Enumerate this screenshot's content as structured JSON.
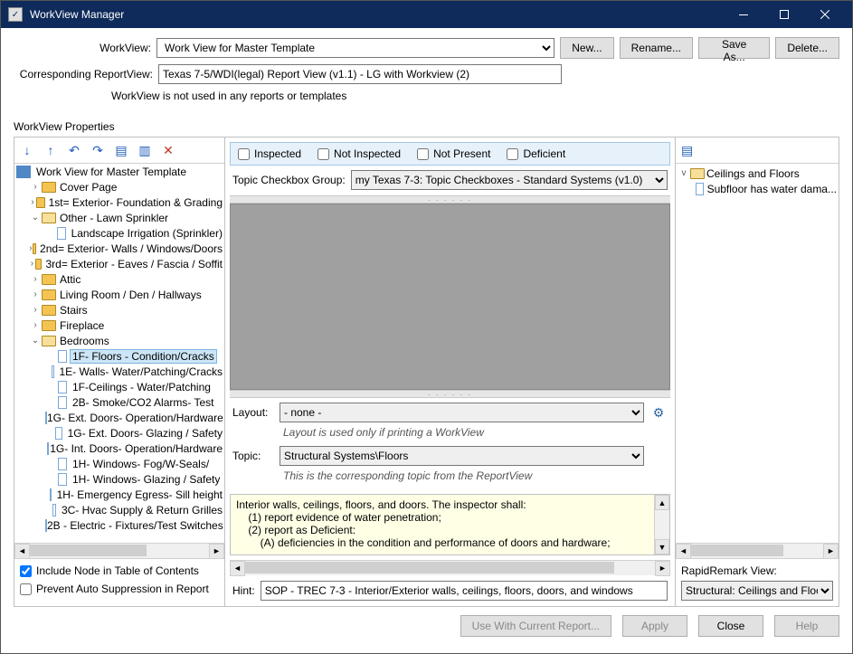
{
  "window": {
    "title": "WorkView Manager"
  },
  "header": {
    "workview_label": "WorkView:",
    "workview_value": "Work View for Master Template",
    "reportview_label": "Corresponding ReportView:",
    "reportview_value": "Texas 7-5/WDI(legal) Report View (v1.1) - LG with Workview (2)",
    "new": "New...",
    "rename": "Rename...",
    "saveas": "Save As...",
    "delete": "Delete...",
    "not_used_msg": "WorkView is not used in any reports or templates"
  },
  "props_label": "WorkView Properties",
  "tree": {
    "root": "Work View for Master Template",
    "items": [
      {
        "exp": "›",
        "indent": 1,
        "icon": "fold",
        "label": "Cover Page"
      },
      {
        "exp": "›",
        "indent": 1,
        "icon": "fold",
        "label": "1st= Exterior- Foundation & Grading"
      },
      {
        "exp": "v",
        "indent": 1,
        "icon": "fold open",
        "label": "Other - Lawn Sprinkler"
      },
      {
        "exp": "",
        "indent": 2,
        "icon": "page",
        "label": "Landscape Irrigation (Sprinkler)"
      },
      {
        "exp": "›",
        "indent": 1,
        "icon": "fold",
        "label": "2nd= Exterior- Walls / Windows/Doors"
      },
      {
        "exp": "›",
        "indent": 1,
        "icon": "fold",
        "label": "3rd= Exterior - Eaves / Fascia / Soffit"
      },
      {
        "exp": "›",
        "indent": 1,
        "icon": "fold",
        "label": "Attic"
      },
      {
        "exp": "›",
        "indent": 1,
        "icon": "fold",
        "label": "Living Room / Den / Hallways"
      },
      {
        "exp": "›",
        "indent": 1,
        "icon": "fold",
        "label": "Stairs"
      },
      {
        "exp": "›",
        "indent": 1,
        "icon": "fold",
        "label": "Fireplace"
      },
      {
        "exp": "v",
        "indent": 1,
        "icon": "fold open",
        "label": "Bedrooms"
      },
      {
        "exp": "",
        "indent": 2,
        "icon": "page",
        "label": "1F- Floors - Condition/Cracks",
        "sel": true
      },
      {
        "exp": "",
        "indent": 2,
        "icon": "page",
        "label": "1E- Walls- Water/Patching/Cracks"
      },
      {
        "exp": "",
        "indent": 2,
        "icon": "page",
        "label": "1F-Ceilings - Water/Patching"
      },
      {
        "exp": "",
        "indent": 2,
        "icon": "page",
        "label": "2B- Smoke/CO2 Alarms- Test"
      },
      {
        "exp": "",
        "indent": 2,
        "icon": "page",
        "label": "1G- Ext. Doors- Operation/Hardware"
      },
      {
        "exp": "",
        "indent": 2,
        "icon": "page",
        "label": "1G- Ext. Doors- Glazing / Safety"
      },
      {
        "exp": "",
        "indent": 2,
        "icon": "page",
        "label": "1G- Int. Doors- Operation/Hardware"
      },
      {
        "exp": "",
        "indent": 2,
        "icon": "page",
        "label": "1H- Windows- Fog/W-Seals/"
      },
      {
        "exp": "",
        "indent": 2,
        "icon": "page",
        "label": "1H- Windows- Glazing / Safety"
      },
      {
        "exp": "",
        "indent": 2,
        "icon": "page",
        "label": "1H- Emergency Egress- Sill height"
      },
      {
        "exp": "",
        "indent": 2,
        "icon": "page",
        "label": "3C- Hvac Supply & Return Grilles"
      },
      {
        "exp": "",
        "indent": 2,
        "icon": "page",
        "label": "2B - Electric - Fixtures/Test Switches"
      }
    ]
  },
  "left_bottom": {
    "include_toc": "Include Node in Table of Contents",
    "include_toc_checked": true,
    "prevent_auto": "Prevent Auto Suppression in Report",
    "prevent_auto_checked": false
  },
  "middle": {
    "inspected": "Inspected",
    "not_inspected": "Not Inspected",
    "not_present": "Not Present",
    "deficient": "Deficient",
    "topic_group_label": "Topic Checkbox Group:",
    "topic_group_value": "my Texas 7-3: Topic Checkboxes - Standard Systems (v1.0)",
    "layout_label": "Layout:",
    "layout_value": "- none -",
    "layout_hint": "Layout is used only if printing a WorkView",
    "topic_label": "Topic:",
    "topic_value": "Structural Systems\\Floors",
    "topic_hint": "This is the corresponding topic from the ReportView",
    "sop_lines": [
      "Interior walls, ceilings, floors, and doors. The inspector shall:",
      "    (1) report evidence of water penetration;",
      "    (2) report as Deficient:",
      "        (A) deficiencies in the condition and performance of doors and hardware;"
    ],
    "hint_label": "Hint:",
    "hint_value": "SOP - TREC 7-3 - Interior/Exterior walls, ceilings, floors, doors, and windows"
  },
  "right": {
    "root": "Ceilings and Floors",
    "child": "Subfloor has water dama...",
    "rapid_label": "RapidRemark View:",
    "rapid_value": "Structural: Ceilings and Floors"
  },
  "footer": {
    "use_with": "Use With Current Report...",
    "apply": "Apply",
    "close": "Close",
    "help": "Help"
  }
}
